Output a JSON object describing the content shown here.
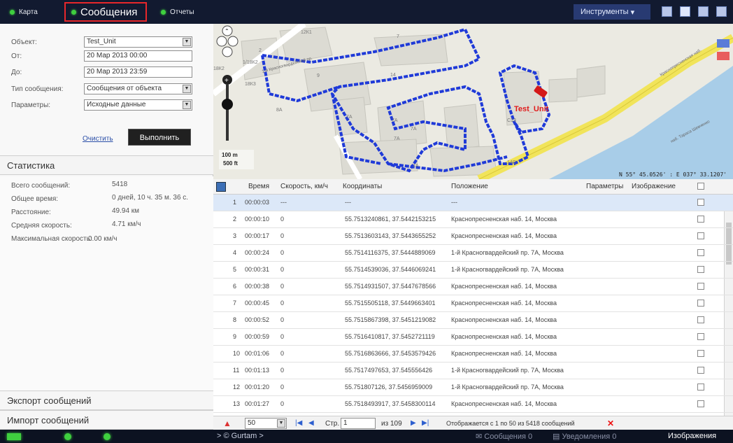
{
  "tabs": {
    "map": "Карта",
    "messages": "Сообщения",
    "reports": "Отчеты"
  },
  "tools_label": "Инструменты",
  "form": {
    "object_label": "Объект:",
    "object_value": "Test_Unit",
    "from_label": "От:",
    "from_value": "20 Мар 2013 00:00",
    "to_label": "До:",
    "to_value": "20 Мар 2013 23:59",
    "type_label": "Тип сообщения:",
    "type_value": "Сообщения от объекта",
    "params_label": "Параметры:",
    "params_value": "Исходные данные",
    "clear": "Очистить",
    "execute": "Выполнить"
  },
  "stats": {
    "title": "Статистика",
    "items": [
      {
        "label": "Всего сообщений:",
        "value": "5418"
      },
      {
        "label": "Общее время:",
        "value": "0 дней, 10 ч. 35 м. 36 с."
      },
      {
        "label": "Расстояние:",
        "value": "49.94 км"
      },
      {
        "label": "Средняя скорость:",
        "value": "4.71 км/ч"
      },
      {
        "label": "Максимальная скорость:",
        "value": "0.00 км/ч"
      }
    ]
  },
  "export_label": "Экспорт сообщений",
  "import_label": "Импорт сообщений",
  "map": {
    "unit_label": "Test_Unit",
    "scale_m": "100 m",
    "scale_ft": "500 ft",
    "coords": "N 55° 45.0526' : E 037° 33.1207'",
    "road1": "1-й Красногвардейский пр.",
    "road2": "Краснопресненская наб.",
    "road3": "наб. Тараса Шевченко",
    "labels": [
      "12К1",
      "2",
      "1/18К2",
      "18К2",
      "18К3",
      "9",
      "14",
      "8А",
      "7А",
      "7А",
      "7А",
      "7А",
      "14С",
      "7А",
      "7",
      "С13"
    ]
  },
  "grid": {
    "headers": {
      "time": "Время",
      "speed": "Скорость, км/ч",
      "coords": "Координаты",
      "position": "Положение",
      "params": "Параметры",
      "image": "Изображение"
    },
    "rows": [
      {
        "n": "1",
        "time": "00:00:03",
        "speed": "---",
        "coords": "---",
        "pos": "---"
      },
      {
        "n": "2",
        "time": "00:00:10",
        "speed": "0",
        "coords": "55.7513240861, 37.5442153215",
        "pos": "Краснопресненская наб. 14, Москва"
      },
      {
        "n": "3",
        "time": "00:00:17",
        "speed": "0",
        "coords": "55.7513603143, 37.5443655252",
        "pos": "Краснопресненская наб. 14, Москва"
      },
      {
        "n": "4",
        "time": "00:00:24",
        "speed": "0",
        "coords": "55.7514116375, 37.5444889069",
        "pos": "1-й Красногвардейский пр. 7А, Москва"
      },
      {
        "n": "5",
        "time": "00:00:31",
        "speed": "0",
        "coords": "55.7514539036, 37.5446069241",
        "pos": "1-й Красногвардейский пр. 7А, Москва"
      },
      {
        "n": "6",
        "time": "00:00:38",
        "speed": "0",
        "coords": "55.7514931507, 37.5447678566",
        "pos": "Краснопресненская наб. 14, Москва"
      },
      {
        "n": "7",
        "time": "00:00:45",
        "speed": "0",
        "coords": "55.7515505118, 37.5449663401",
        "pos": "Краснопресненская наб. 14, Москва"
      },
      {
        "n": "8",
        "time": "00:00:52",
        "speed": "0",
        "coords": "55.7515867398, 37.5451219082",
        "pos": "Краснопресненская наб. 14, Москва"
      },
      {
        "n": "9",
        "time": "00:00:59",
        "speed": "0",
        "coords": "55.7516410817, 37.5452721119",
        "pos": "Краснопресненская наб. 14, Москва"
      },
      {
        "n": "10",
        "time": "00:01:06",
        "speed": "0",
        "coords": "55.7516863666, 37.5453579426",
        "pos": "Краснопресненская наб. 14, Москва"
      },
      {
        "n": "11",
        "time": "00:01:13",
        "speed": "0",
        "coords": "55.7517497653, 37.545556426",
        "pos": "1-й Красногвардейский пр. 7А, Москва"
      },
      {
        "n": "12",
        "time": "00:01:20",
        "speed": "0",
        "coords": "55.751807126, 37.5456959009",
        "pos": "1-й Красногвардейский пр. 7А, Москва"
      },
      {
        "n": "13",
        "time": "00:01:27",
        "speed": "0",
        "coords": "55.7518493917, 37.5458300114",
        "pos": "Краснопресненская наб. 14, Москва"
      }
    ]
  },
  "pager": {
    "per_page": "50",
    "page_label": "Стр.",
    "page": "1",
    "of": "из 109",
    "info": "Отображается с 1 по 50 из 5418 сообщений"
  },
  "footer": {
    "gurtam": "> © Gurtam >",
    "messages": "Сообщения 0",
    "notifications": "Уведомления 0",
    "images": "Изображения"
  }
}
